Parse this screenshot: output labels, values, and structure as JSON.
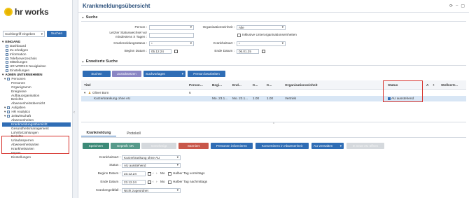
{
  "logo": {
    "text": "hr works"
  },
  "search": {
    "placeholder": "Suchbegriff eingeben",
    "button": "Suchen"
  },
  "nav": [
    {
      "label": "EINGANG",
      "type": "section"
    },
    {
      "label": "Dashboard",
      "type": "item"
    },
    {
      "label": "Zu erledigen",
      "type": "item"
    },
    {
      "label": "Information",
      "type": "item"
    },
    {
      "label": "Telefonverzeichnis",
      "type": "item"
    },
    {
      "label": "Mitteilungen",
      "type": "item"
    },
    {
      "label": "HR WORKS Neuigkeiten",
      "type": "item"
    },
    {
      "label": "Einstellungen",
      "type": "item"
    },
    {
      "label": "ADMIN UNTERNEHMEN",
      "type": "section"
    },
    {
      "label": "Personen",
      "type": "group"
    },
    {
      "label": "Personen",
      "type": "sub"
    },
    {
      "label": "Organigramm",
      "type": "sub"
    },
    {
      "label": "Ereignisse",
      "type": "sub"
    },
    {
      "label": "Aufbauorganisation",
      "type": "sub"
    },
    {
      "label": "Berichte",
      "type": "sub"
    },
    {
      "label": "Abwesenheitsübersicht",
      "type": "sub"
    },
    {
      "label": "Aufgaben",
      "type": "group"
    },
    {
      "label": "HR Analytics",
      "type": "group"
    },
    {
      "label": "Zeitwirtschaft",
      "type": "group"
    },
    {
      "label": "Abwesenheiten",
      "type": "sub"
    },
    {
      "label": "Krankmeldungsübersicht",
      "type": "active"
    },
    {
      "label": "Gesundheitsmanagement",
      "type": "sub"
    },
    {
      "label": "Lohnfortzahlungen",
      "type": "sub"
    },
    {
      "label": "Berichte",
      "type": "sub"
    },
    {
      "label": "Urlaubssperren",
      "type": "sub"
    },
    {
      "label": "Abwesenheitsarten",
      "type": "sub"
    },
    {
      "label": "Krankheitsarten",
      "type": "sub"
    },
    {
      "label": "Import",
      "type": "sub"
    },
    {
      "label": "Einstellungen",
      "type": "sub"
    }
  ],
  "page": {
    "title": "Krankmeldungsübersicht"
  },
  "suche": {
    "heading": "Suche",
    "person_label": "Person :",
    "person_value": "",
    "letzter_label_1": "Letzter Statuswechsel vor",
    "letzter_label_2": "mindestens X Tagen :",
    "krankmeldungsstatus_label": "Krankmeldungsstatus :",
    "krankmeldungsstatus_value": "*",
    "beginn_label": "Beginn Datum :",
    "beginn_value": "05.12.24",
    "org_label": "Organisationseinheit :",
    "org_value": "Alle",
    "inkl_label": "Inklusive Unterorganisationseinheiten",
    "krankheitsart_label": "Krankheitsart :",
    "krankheitsart_value": "*",
    "ende_label": "Ende Datum :",
    "ende_value": "06.01.25"
  },
  "erweitert": {
    "heading": "Erweiterte Suche"
  },
  "actions": {
    "suchen": "Suchen",
    "zuruecksetzen": "Zurücksetzen",
    "suchvorlagen": "Suchvorlagen",
    "person_bearbeiten": "Person bearbeiten"
  },
  "grid": {
    "headers": [
      "Titel",
      "Person...",
      "Begi...",
      "End...",
      "K...",
      "K...",
      "Organisationseinheit",
      "Status",
      "A",
      "+",
      "Stellvertr..."
    ],
    "group_row": {
      "name": "Oliver Born",
      "count": "6"
    },
    "data_row": {
      "title": "Kurzerkrankung ohne AU",
      "begin": "Mo. 23.1...",
      "end": "Mo. 23.1...",
      "k1": "1.00",
      "k2": "1.00",
      "org": "Vertrieb",
      "status": "AU ausstehend"
    }
  },
  "tabs": [
    "Krankmeldung",
    "Protokoll"
  ],
  "detail_actions": {
    "speichern": "Speichern",
    "geprueft": "Geprüft: OK",
    "genehmigt": "Genehmigt",
    "storniert": "Storniert",
    "person_informieren": "Personen informieren",
    "konvertieren": "Konvertieren in Abwesenheit",
    "au_verwalten": "AU verwalten",
    "au_erstellen": "In neue AU öffnen"
  },
  "detail": {
    "krankheitsart_label": "Krankheitsart :",
    "krankheitsart_value": "Kurzerkrankung ohne AU",
    "status_label": "Status :",
    "status_value": "AU ausstehend",
    "beginn_label": "Beginn Datum :",
    "beginn_value": "23.12.24",
    "beginn_weekday": "Mo",
    "halber_tag_vormittags": "Halber Tag vormittags",
    "ende_label": "Ende Datum :",
    "ende_value": "23.12.24",
    "ende_weekday": "Mo",
    "halber_tag_nachmittags": "Halber Tag nachmittags",
    "krankengeldfall_label": "Krankengeldfall :",
    "krankengeldfall_value": "Nicht zugeordnet"
  },
  "colors": {
    "accent": "#2f6db5",
    "highlight": "#d6312b"
  }
}
